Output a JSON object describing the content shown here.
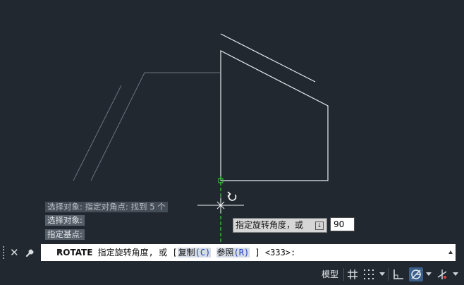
{
  "command_history": [
    "选择对象: 指定对角点: 找到 5 个",
    "选择对象:",
    "指定基点:"
  ],
  "tooltip": {
    "prompt": "指定旋转角度，或"
  },
  "dynamic_input": {
    "value": "90"
  },
  "command_line": {
    "command": "ROTATE",
    "prompt": "指定旋转角度, 或 [",
    "options": [
      {
        "label": "复制",
        "key": "(C)"
      },
      {
        "label": "参照",
        "key": "(R)"
      }
    ],
    "suffix": "] <333>:"
  },
  "status_bar": {
    "model_label": "模型",
    "icons": [
      "grid-icon",
      "snap-icon",
      "ortho-icon",
      "polar-tracking-icon",
      "isodraft-icon"
    ]
  },
  "colors": {
    "background": "#212830",
    "geometry": "#e8ecef",
    "preview": "#6b7480",
    "axis": "#3cd23c",
    "option_highlight": "#d5dce6",
    "option_key": "#1f3fc7"
  }
}
